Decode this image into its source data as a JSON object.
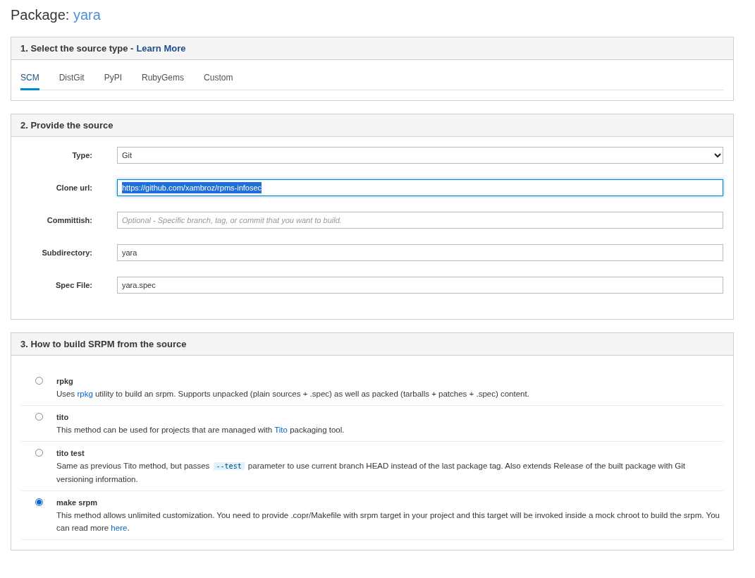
{
  "page_title": {
    "label": "Package:",
    "name": "yara"
  },
  "source_type": {
    "heading": "1. Select the source type -",
    "link": "Learn More",
    "tabs": [
      {
        "label": "SCM",
        "selected": true
      },
      {
        "label": "DistGit",
        "selected": false
      },
      {
        "label": "PyPI",
        "selected": false
      },
      {
        "label": "RubyGems",
        "selected": false
      },
      {
        "label": "Custom",
        "selected": false
      }
    ]
  },
  "source": {
    "heading": "2. Provide the source",
    "fields": [
      {
        "kind": "select",
        "label": "Type:",
        "value": "Git"
      },
      {
        "kind": "text",
        "label": "Clone url:",
        "value": "https://github.com/xambroz/rpms-infosec",
        "focused": true,
        "text_selected": true
      },
      {
        "kind": "text",
        "label": "Committish:",
        "placeholder": "Optional - Specific branch, tag, or commit that you want to build.",
        "focused": false
      },
      {
        "kind": "text",
        "label": "Subdirectory:",
        "value": "yara",
        "focused": false,
        "text_selected": false
      },
      {
        "kind": "text",
        "label": "Spec File:",
        "value": "yara.spec",
        "focused": false,
        "text_selected": false
      }
    ]
  },
  "build": {
    "heading": "3. How to build SRPM from the source",
    "methods": [
      {
        "name": "rpkg",
        "selected": false,
        "description": [
          {
            "kind": "text",
            "text": "Uses "
          },
          {
            "kind": "link",
            "text": "rpkg"
          },
          {
            "kind": "text",
            "text": " utility to build an srpm. Supports unpacked (plain sources + .spec) as well as packed (tarballs + patches + .spec) content."
          }
        ]
      },
      {
        "name": "tito",
        "selected": false,
        "description": [
          {
            "kind": "text",
            "text": "This method can be used for projects that are managed with "
          },
          {
            "kind": "link",
            "text": "Tito"
          },
          {
            "kind": "text",
            "text": " packaging tool."
          }
        ]
      },
      {
        "name": "tito test",
        "selected": false,
        "description": [
          {
            "kind": "text",
            "text": "Same as previous Tito method, but passes "
          },
          {
            "kind": "code",
            "text": "--test"
          },
          {
            "kind": "text",
            "text": " parameter to use current branch HEAD instead of the last package tag. Also extends Release of the built package with Git versioning information."
          }
        ]
      },
      {
        "name": "make srpm",
        "selected": true,
        "description": [
          {
            "kind": "text",
            "text": "This method allows unlimited customization. You need to provide .copr/Makefile with srpm target in your project and this target will be invoked inside a mock chroot to build the srpm. You can read more "
          },
          {
            "kind": "link",
            "text": "here"
          },
          {
            "kind": "text",
            "text": "."
          }
        ]
      }
    ]
  }
}
